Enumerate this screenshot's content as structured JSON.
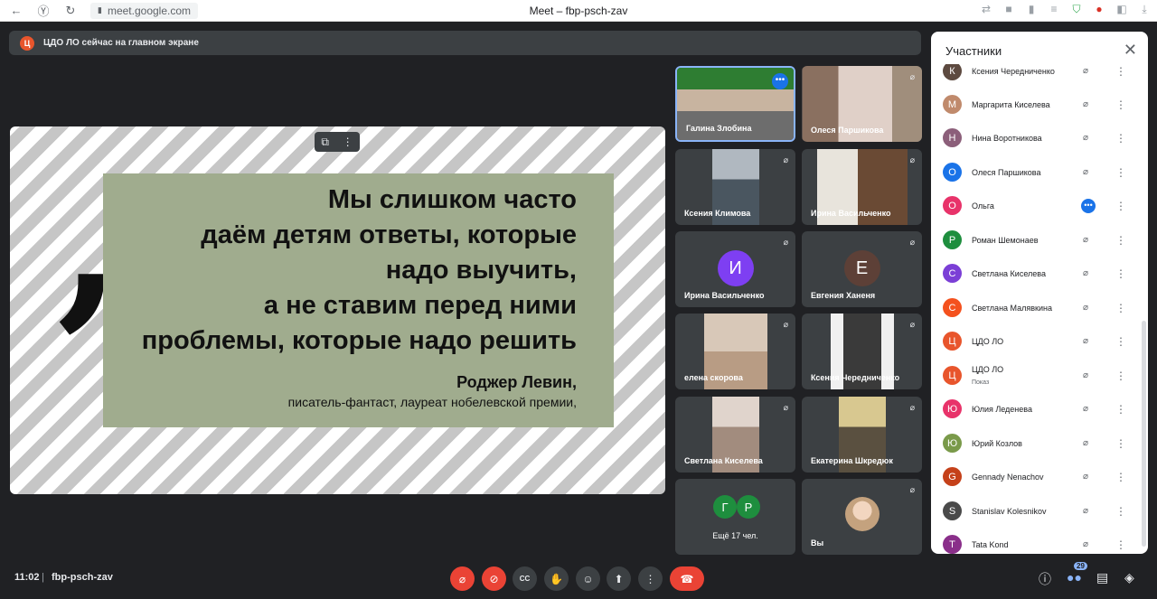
{
  "browser": {
    "url": "meet.google.com",
    "title": "Meet – fbp-psch-zav"
  },
  "banner": {
    "avatar_letter": "Ц",
    "text": "ЦДО ЛО сейчас на главном экране",
    "avatar_color": "#e8552c"
  },
  "presentation": {
    "quote_lines": [
      "Мы слишком часто",
      "даём детям ответы, которые",
      "надо выучить,",
      "а не ставим перед ними",
      "проблемы, которые надо решить"
    ],
    "author": "Роджер Левин,",
    "author_role": "писатель-фантаст, лауреат нобелевской премии,"
  },
  "tiles": [
    {
      "name": "Галина Злобина",
      "kind": "video",
      "active": true,
      "status": "speaking",
      "bg": "#6d8a6a"
    },
    {
      "name": "Олеся Паршикова",
      "kind": "video",
      "status": "muted",
      "bg": "#a08e7c"
    },
    {
      "name": "Ксения Климова",
      "kind": "video",
      "status": "muted",
      "bg": "#8a9299"
    },
    {
      "name": "Ирина Васильченко",
      "kind": "video",
      "status": "muted",
      "bg": "#8b6b55"
    },
    {
      "name": "Ирина Васильченко",
      "kind": "avatar",
      "letter": "И",
      "color": "#7e3ff2",
      "status": "muted"
    },
    {
      "name": "Евгения Ханеня",
      "kind": "avatar",
      "letter": "Е",
      "color": "#5d4037",
      "status": "muted"
    },
    {
      "name": "елена скорова",
      "kind": "video",
      "status": "muted",
      "bg": "#b89c84"
    },
    {
      "name": "Ксения Чередниченко",
      "kind": "video",
      "status": "muted",
      "bg": "#5a5a5a"
    },
    {
      "name": "Светлана Киселева",
      "kind": "video",
      "status": "muted",
      "bg": "#a28c7e"
    },
    {
      "name": "Екатерина Шкредюк",
      "kind": "video",
      "status": "muted",
      "bg": "#9a8a70"
    },
    {
      "name": "Ещё 17 чел.",
      "kind": "group",
      "letters": [
        "Г",
        "Р"
      ],
      "colors": [
        "#1e8e3e",
        "#1e8e3e"
      ]
    },
    {
      "name": "Вы",
      "kind": "self",
      "status": "muted",
      "bg": "#c4a27e"
    }
  ],
  "participants_panel": {
    "title": "Участники",
    "people": [
      {
        "name": "Ксения Чередниченко",
        "letter": "К",
        "color": "#5d4a40",
        "status": "muted"
      },
      {
        "name": "Маргарита Киселева",
        "letter": "М",
        "color": "#c08a6c",
        "status": "muted"
      },
      {
        "name": "Нина Воротникова",
        "letter": "Н",
        "color": "#8c5f7a",
        "status": "muted"
      },
      {
        "name": "Олеся Паршикова",
        "letter": "О",
        "color": "#1a73e8",
        "status": "muted"
      },
      {
        "name": "Ольга",
        "letter": "О",
        "color": "#e8336a",
        "status": "speaking"
      },
      {
        "name": "Роман Шемонаев",
        "letter": "Р",
        "color": "#1e8e3e",
        "status": "muted"
      },
      {
        "name": "Светлана Киселева",
        "letter": "С",
        "color": "#7b3fd6",
        "status": "muted"
      },
      {
        "name": "Светлана Малявкина",
        "letter": "С",
        "color": "#f4511e",
        "status": "muted"
      },
      {
        "name": "ЦДО ЛО",
        "letter": "Ц",
        "color": "#e8552c",
        "status": "muted"
      },
      {
        "name": "ЦДО ЛО",
        "sub": "Показ",
        "letter": "Ц",
        "color": "#e8552c",
        "status": "presenting"
      },
      {
        "name": "Юлия Леденева",
        "letter": "Ю",
        "color": "#e8336a",
        "status": "muted"
      },
      {
        "name": "Юрий Козлов",
        "letter": "Ю",
        "color": "#7a9a4a",
        "status": "muted"
      },
      {
        "name": "Gennady Nenachov",
        "letter": "G",
        "color": "#c5411a",
        "status": "muted"
      },
      {
        "name": "Stanislav Kolesnikov",
        "letter": "S",
        "color": "#4a4a4a",
        "status": "muted"
      },
      {
        "name": "Tata Kond",
        "letter": "T",
        "color": "#8a2f8a",
        "status": "muted"
      }
    ]
  },
  "bottom_bar": {
    "time": "11:02",
    "separator": "|",
    "meeting_code": "fbp-psch-zav",
    "participant_count": "29"
  },
  "icons": {
    "back": "←",
    "forward_y": "Ⓨ",
    "reload": "↻",
    "lock": "🔒",
    "mic_off": "🎙",
    "close": "✕",
    "more_vert": "⋮",
    "more_horiz": "•••",
    "cam_off": "⊘",
    "cc": "CC",
    "hand": "✋",
    "emoji": "☺",
    "present": "⬆",
    "hangup": "☎",
    "info": "ⓘ",
    "people": "👥",
    "chat": "💬",
    "activities": "⚙",
    "popout": "⧉"
  }
}
